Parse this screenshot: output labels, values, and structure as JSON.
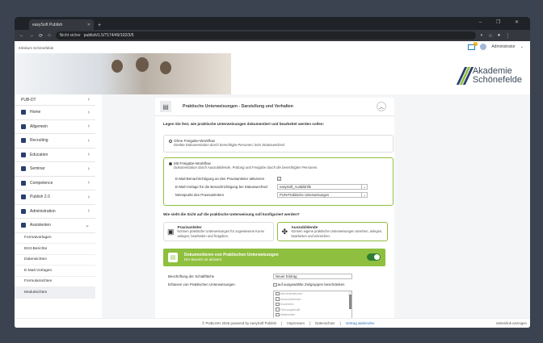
{
  "browser": {
    "tab_title": "easySoft Publish",
    "insecure_label": "Nicht sicher",
    "url": "publish/1.5/?174/49/102/3/5"
  },
  "header": {
    "brand": "Klinikum Schönefelde",
    "mail_count": "1",
    "user": "Administrator",
    "logo_line1": "Akademie",
    "logo_line2": "Schönefelde",
    "logo_colors": [
      "#2a3f6e",
      "#8fbf3f"
    ]
  },
  "sidebar": {
    "pub_label": "PUB-DT",
    "items": [
      {
        "label": "Home",
        "icon": "home-icon"
      },
      {
        "label": "Allgemein",
        "icon": "users-icon"
      },
      {
        "label": "Recruiting",
        "icon": "megaphone-icon"
      },
      {
        "label": "Education",
        "icon": "graduation-icon"
      },
      {
        "label": "Seminar",
        "icon": "seminar-icon"
      },
      {
        "label": "Competence",
        "icon": "competence-icon"
      },
      {
        "label": "Publish 2.0",
        "icon": "publish-icon"
      },
      {
        "label": "Administration",
        "icon": "gear-icon"
      },
      {
        "label": "Assistenten",
        "icon": "assistant-icon"
      }
    ],
    "subitems": [
      "Formatvorlagen",
      "EK3-Berichte",
      "Datensichten",
      "E-Mail-Vorlagen",
      "Formularsichten",
      "Modulsichten"
    ]
  },
  "card": {
    "title": "Praktische Unterweisungen - Darstellung und Verhalten",
    "question1": "Legen Sie fest, wie praktische Unterweisungen dokumentiert und bearbeitet werden sollen:",
    "option1_label": "Ohne Freigabe-Workflow",
    "option1_desc": "Direkte Dokumentation durch berechtigte Personen; kein Statuswechsel.",
    "option2_label": "Mit Freigabe-Workflow",
    "option2_desc": "Dokumentation durch Auszubildende, Prüfung und Freigabe durch die berechtigten Personen.",
    "email_notify_label": "E-Mail-Benachrichtigung an den Praxisanleiter aktivieren",
    "email_template_label": "E-Mail-Vorlage für die Benachrichtigung bei Statuswechsel",
    "email_template_value": "easySoft_Ausbildnlfe",
    "menu_label": "Menüpunkt des Praxisanleiters",
    "menu_value": "PUN-Praktische Unterweisungen",
    "question2": "Wie sieht die Sicht auf die praktische Unterweisung soll konfiguriert werden?",
    "choice1_title": "Praxisanleiter",
    "choice1_desc": "Können praktische Unterweisungen für zugewiesene Kurse anlegen, bearbeiten und freigeben.",
    "choice2_title": "Auszubildende",
    "choice2_desc": "Können eigene praktische Unterweisungen ansehen, anlegen, bearbeiten und einreichen.",
    "docu_title": "Dokumentieren von Praktischen Unterweisungen",
    "docu_sub": "Der Bereich ist aktiviert",
    "button_label": "Beschriftung der Schaltfläche",
    "button_value": "Neuer Eintrag",
    "capture_label": "Erfassen von Praktischen Unterweisungen",
    "restrict_label": "auf ausgewählte Zielgruppen beschränken",
    "groups": [
      "Administratoren",
      "Auszubildende",
      "Dozenten",
      "Führungskraft",
      "Mitarbeiter"
    ]
  },
  "footer": {
    "copyright": "© PUBLISH 2026 powered by easySoft Publish",
    "impressum": "Impressum",
    "datenschutz": "Datenschutz",
    "consent": "Vertrag widerrufen",
    "page_id": "Seitenlink anzeigen"
  }
}
